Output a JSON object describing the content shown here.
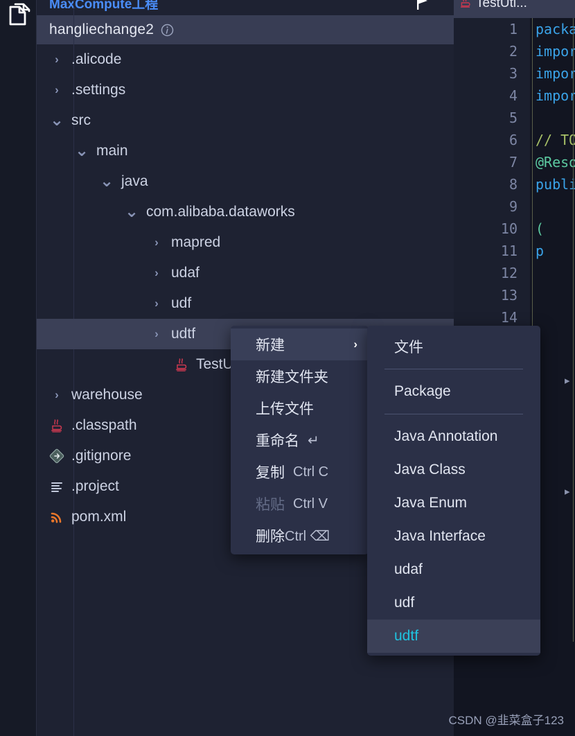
{
  "activity_bar": {
    "icons": [
      {
        "name": "files-explorer-icon",
        "label": "Files"
      }
    ]
  },
  "explorer": {
    "panel_title": "MaxCompute工程",
    "flag_icon": "flag-icon",
    "project": {
      "name": "hangliechange2",
      "info_icon": "info-circle-icon"
    },
    "tree": [
      {
        "label": ".alicode",
        "indent": 0,
        "twisty": "collapsed",
        "icon": "folder",
        "selected": false
      },
      {
        "label": ".settings",
        "indent": 0,
        "twisty": "collapsed",
        "icon": "folder",
        "selected": false
      },
      {
        "label": "src",
        "indent": 0,
        "twisty": "expanded",
        "icon": "folder",
        "selected": false
      },
      {
        "label": "main",
        "indent": 1,
        "twisty": "expanded",
        "icon": "folder",
        "selected": false
      },
      {
        "label": "java",
        "indent": 2,
        "twisty": "expanded",
        "icon": "folder",
        "selected": false
      },
      {
        "label": "com.alibaba.dataworks",
        "indent": 3,
        "twisty": "expanded",
        "icon": "folder",
        "selected": false
      },
      {
        "label": "mapred",
        "indent": 4,
        "twisty": "collapsed",
        "icon": "folder",
        "selected": false
      },
      {
        "label": "udaf",
        "indent": 4,
        "twisty": "collapsed",
        "icon": "folder",
        "selected": false
      },
      {
        "label": "udf",
        "indent": 4,
        "twisty": "collapsed",
        "icon": "folder",
        "selected": false
      },
      {
        "label": "udtf",
        "indent": 4,
        "twisty": "collapsed",
        "icon": "folder",
        "selected": true
      },
      {
        "label": "TestUti",
        "indent": 5,
        "twisty": "none",
        "icon": "java",
        "selected": false
      },
      {
        "label": "warehouse",
        "indent": 0,
        "twisty": "collapsed",
        "icon": "folder",
        "selected": false
      },
      {
        "label": ".classpath",
        "indent": 0,
        "twisty": "none",
        "icon": "java",
        "selected": false
      },
      {
        "label": ".gitignore",
        "indent": 0,
        "twisty": "none",
        "icon": "git",
        "selected": false
      },
      {
        "label": ".project",
        "indent": 0,
        "twisty": "none",
        "icon": "text",
        "selected": false
      },
      {
        "label": "pom.xml",
        "indent": 0,
        "twisty": "none",
        "icon": "xml",
        "selected": false
      }
    ]
  },
  "editor": {
    "tab": {
      "icon": "java-icon",
      "title": "TestUti..."
    },
    "line_numbers": [
      "1",
      "2",
      "3",
      "4",
      "5",
      "6",
      "7",
      "8",
      "9",
      "10",
      "11",
      "12",
      "13",
      "14"
    ],
    "code_lines": [
      {
        "text": "packa",
        "type": "keyword"
      },
      {
        "text": "impor",
        "type": "keyword"
      },
      {
        "text": "impor",
        "type": "keyword"
      },
      {
        "text": "impor",
        "type": "keyword"
      },
      {
        "text": "",
        "type": "plain"
      },
      {
        "text": "// TO",
        "type": "comment"
      },
      {
        "text": "@Reso",
        "type": "annotation"
      },
      {
        "text": "publi",
        "type": "keyword"
      },
      {
        "text": "",
        "type": "plain"
      },
      {
        "text": "(",
        "type": "annotation"
      },
      {
        "text": "p",
        "type": "keyword"
      },
      {
        "text": "",
        "type": "plain"
      },
      {
        "text": "",
        "type": "plain"
      },
      {
        "text": "",
        "type": "plain"
      }
    ]
  },
  "context_menu": {
    "items": [
      {
        "label": "新建",
        "shortcut": "",
        "has_submenu": true,
        "active": true,
        "disabled": false
      },
      {
        "label": "新建文件夹",
        "shortcut": "",
        "has_submenu": false,
        "active": false,
        "disabled": false
      },
      {
        "label": "上传文件",
        "shortcut": "",
        "has_submenu": false,
        "active": false,
        "disabled": false
      },
      {
        "label": "重命名",
        "shortcut": "↵",
        "has_submenu": false,
        "active": false,
        "disabled": false
      },
      {
        "label": "复制",
        "shortcut": "Ctrl C",
        "has_submenu": false,
        "active": false,
        "disabled": false
      },
      {
        "label": "粘贴",
        "shortcut": "Ctrl V",
        "has_submenu": false,
        "active": false,
        "disabled": true
      },
      {
        "label": "删除",
        "shortcut": "Ctrl ⌫",
        "has_submenu": false,
        "active": false,
        "disabled": false
      }
    ]
  },
  "sub_menu": {
    "items": [
      {
        "label": "文件",
        "highlight": false,
        "separator_after": true
      },
      {
        "label": "Package",
        "highlight": false,
        "separator_after": true
      },
      {
        "label": "Java Annotation",
        "highlight": false,
        "separator_after": false
      },
      {
        "label": "Java Class",
        "highlight": false,
        "separator_after": false
      },
      {
        "label": "Java Enum",
        "highlight": false,
        "separator_after": false
      },
      {
        "label": "Java Interface",
        "highlight": false,
        "separator_after": false
      },
      {
        "label": "udaf",
        "highlight": false,
        "separator_after": false
      },
      {
        "label": "udf",
        "highlight": false,
        "separator_after": false
      },
      {
        "label": "udtf",
        "highlight": true,
        "separator_after": false
      }
    ]
  },
  "watermark": {
    "text": "CSDN @韭菜盒子123"
  },
  "colors": {
    "panel_bg": "#1e2232",
    "activity_bg": "#161a26",
    "editor_bg": "#121521",
    "selection": "#3b4057",
    "menu_bg": "#2b3047",
    "accent_cyan": "#1fc3e0",
    "title_blue": "#4a8df8",
    "text": "#ccd2e3"
  }
}
